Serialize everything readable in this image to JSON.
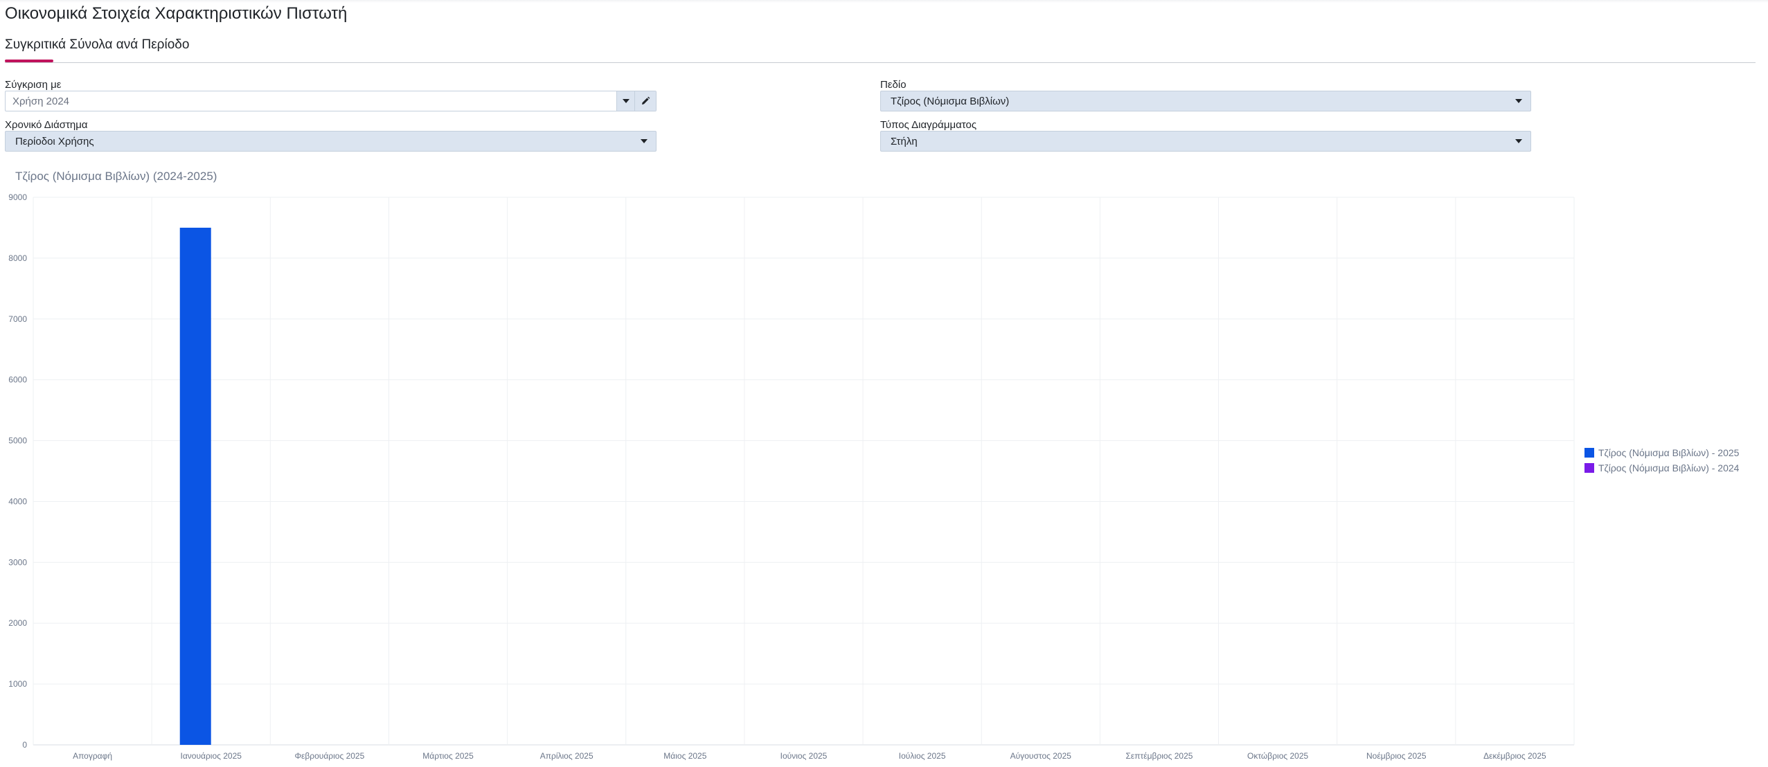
{
  "page": {
    "title": "Οικονομικά Στοιχεία Χαρακτηριστικών Πιστωτή",
    "tab_label": "Συγκριτικά Σύνολα ανά Περίοδο"
  },
  "filters": {
    "compare_label": "Σύγκριση με",
    "compare_value": "Χρήση 2024",
    "field_label": "Πεδίο",
    "field_value": "Τζίρος (Νόμισμα Βιβλίων)",
    "range_label": "Χρονικό Διάστημα",
    "range_value": "Περίοδοι Χρήσης",
    "chart_type_label": "Τύπος Διαγράμματος",
    "chart_type_value": "Στήλη"
  },
  "chart_data": {
    "type": "bar",
    "title": "Τζίρος (Νόμισμα Βιβλίων) (2024-2025)",
    "categories": [
      "Απογραφή",
      "Ιανουάριος 2025",
      "Φεβρουάριος 2025",
      "Μάρτιος 2025",
      "Απρίλιος 2025",
      "Μάιος 2025",
      "Ιούνιος 2025",
      "Ιούλιος 2025",
      "Αύγουστος 2025",
      "Σεπτέμβριος 2025",
      "Οκτώβριος 2025",
      "Νοέμβριος 2025",
      "Δεκέμβριος 2025"
    ],
    "series": [
      {
        "name": "Τζίρος (Νόμισμα Βιβλίων) - 2025",
        "color": "#0b55e4",
        "values": [
          0,
          8500,
          0,
          0,
          0,
          0,
          0,
          0,
          0,
          0,
          0,
          0,
          0
        ]
      },
      {
        "name": "Τζίρος (Νόμισμα Βιβλίων) - 2024",
        "color": "#7a1be8",
        "values": [
          0,
          0,
          0,
          0,
          0,
          0,
          0,
          0,
          0,
          0,
          0,
          0,
          0
        ]
      }
    ],
    "yticks": [
      "0",
      "1000",
      "2000",
      "3000",
      "4000",
      "5000",
      "6000",
      "7000",
      "8000",
      "9000"
    ],
    "ylim": [
      0,
      9000
    ],
    "grid": true,
    "legend_position": "right"
  }
}
